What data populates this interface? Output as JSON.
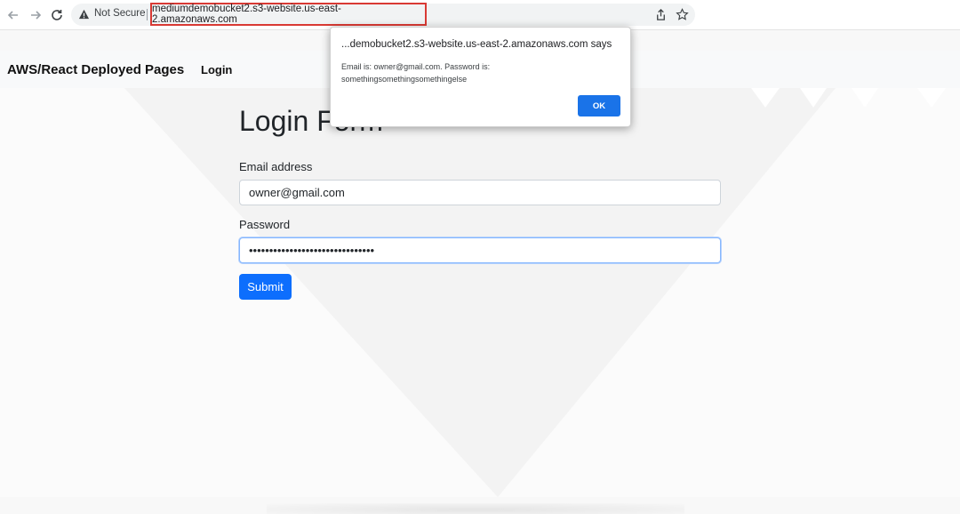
{
  "browser": {
    "security_label": "Not Secure",
    "url": "mediumdemobucket2.s3-website.us-east-2.amazonaws.com",
    "icons": [
      "back-icon",
      "forward-icon",
      "reload-icon",
      "warning-icon",
      "share-icon",
      "star-icon"
    ],
    "url_highlight_color": "#d93a34"
  },
  "navbar": {
    "brand": "AWS/React Deployed Pages",
    "link_login": "Login"
  },
  "form": {
    "title": "Login Form",
    "email_label": "Email address",
    "email_value": "owner@gmail.com",
    "password_label": "Password",
    "password_value": "somethingsomethingsomethingelse",
    "submit_label": "Submit",
    "accent_color": "#0d6efd"
  },
  "dialog": {
    "title": "...demobucket2.s3-website.us-east-2.amazonaws.com says",
    "message": "Email is: owner@gmail.com. Password is: somethingsomethingsomethingelse",
    "ok_label": "OK",
    "ok_color": "#1a73e8"
  }
}
